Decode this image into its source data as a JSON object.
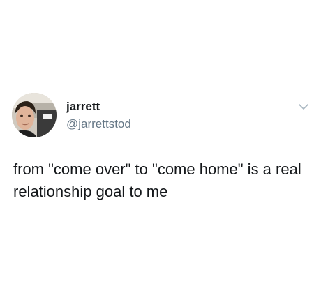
{
  "tweet": {
    "display_name": "jarrett",
    "handle": "@jarrettstod",
    "text": "from \"come over\" to \"come home\" is a real relationship goal to me"
  },
  "icons": {
    "menu": "chevron-down-icon",
    "avatar": "profile-photo"
  },
  "colors": {
    "name": "#14171a",
    "handle": "#657786",
    "text": "#14171a",
    "chevron": "#aab8c2"
  }
}
